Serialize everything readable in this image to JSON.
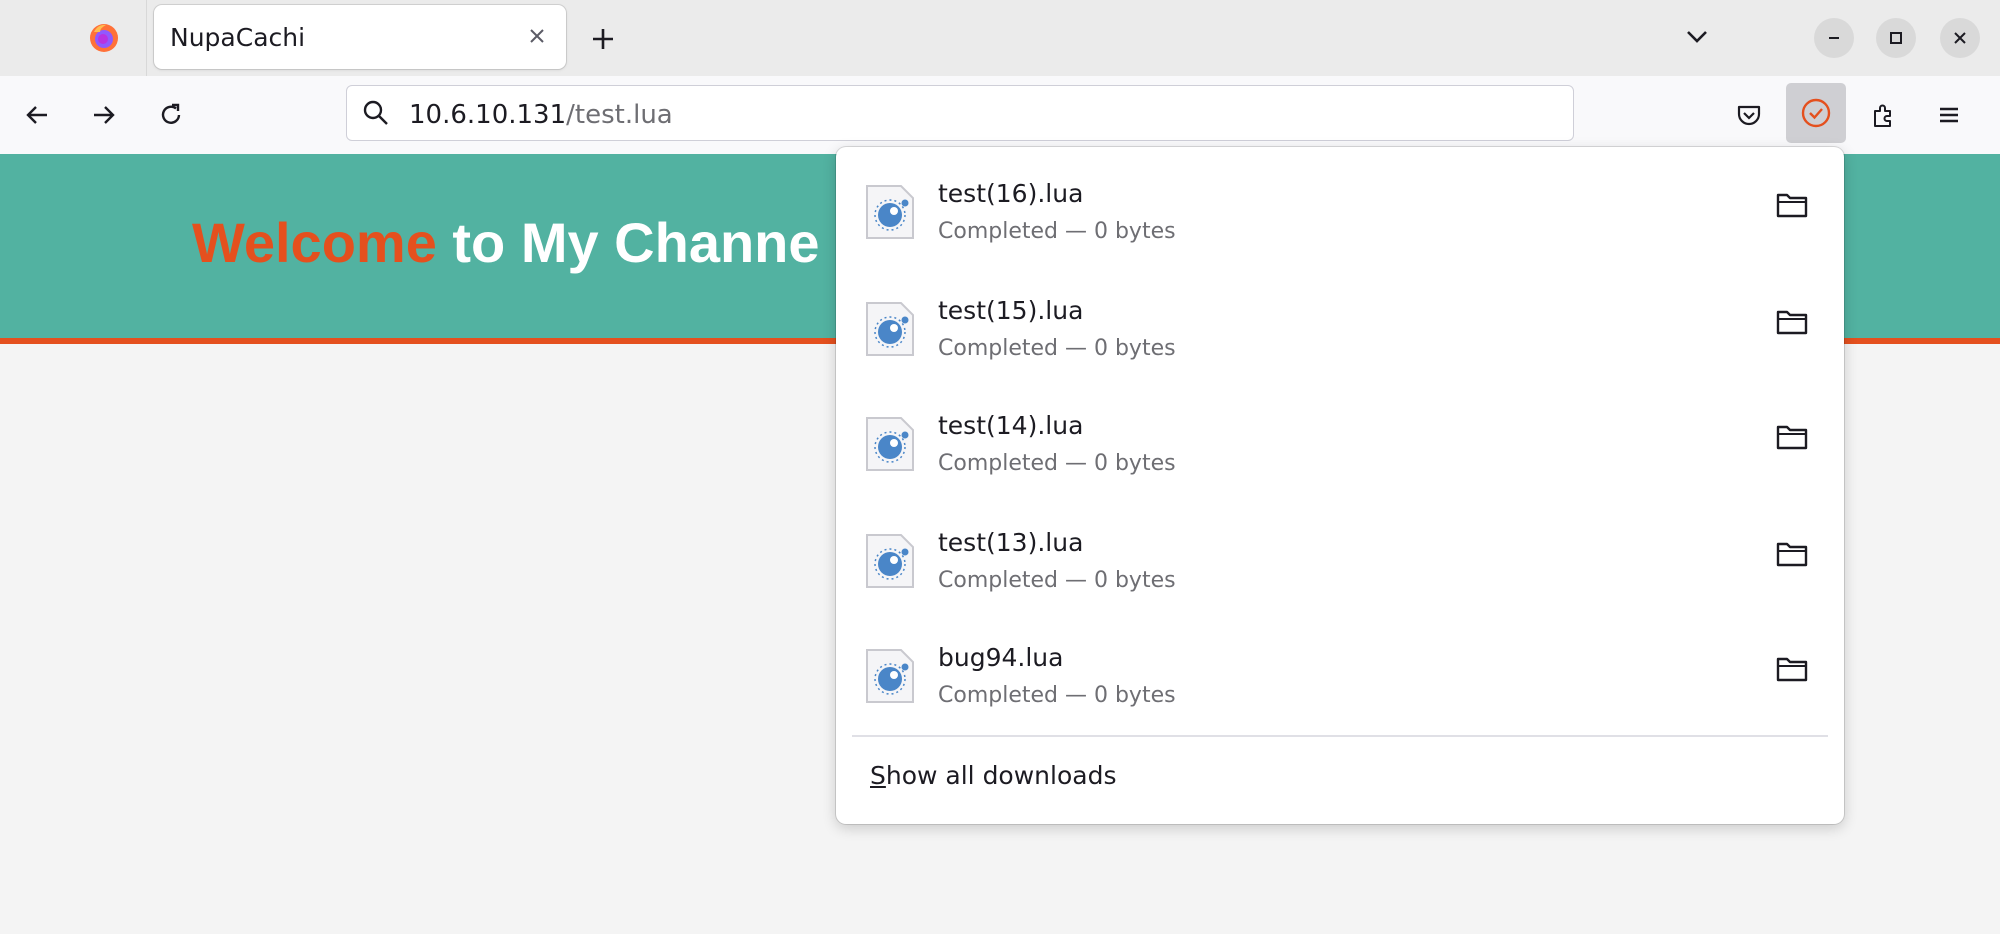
{
  "browser": {
    "tab": {
      "title": "NupaCachi",
      "close_icon": "close-icon"
    },
    "new_tab_icon": "plus-icon",
    "list_tabs_icon": "chevron-down-icon",
    "window_controls": [
      "minimize-icon",
      "maximize-icon",
      "close-icon"
    ]
  },
  "navbar": {
    "url_host": "10.6.10.131",
    "url_path": "/test.lua",
    "icons": [
      "back-arrow-icon",
      "forward-arrow-icon",
      "reload-icon",
      "search-icon",
      "pocket-icon",
      "downloads-icon",
      "extensions-icon",
      "menu-icon"
    ]
  },
  "page": {
    "banner_word1": "Welcome",
    "banner_rest": " to My Channe",
    "colors": {
      "banner": "#52b2a1",
      "accent": "#e4501e"
    }
  },
  "downloads": {
    "items": [
      {
        "name": "test(16).lua",
        "status": "Completed — 0 bytes"
      },
      {
        "name": "test(15).lua",
        "status": "Completed — 0 bytes"
      },
      {
        "name": "test(14).lua",
        "status": "Completed — 0 bytes"
      },
      {
        "name": "test(13).lua",
        "status": "Completed — 0 bytes"
      },
      {
        "name": "bug94.lua",
        "status": "Completed — 0 bytes"
      }
    ],
    "show_all_first": "S",
    "show_all_rest": "how all downloads"
  }
}
